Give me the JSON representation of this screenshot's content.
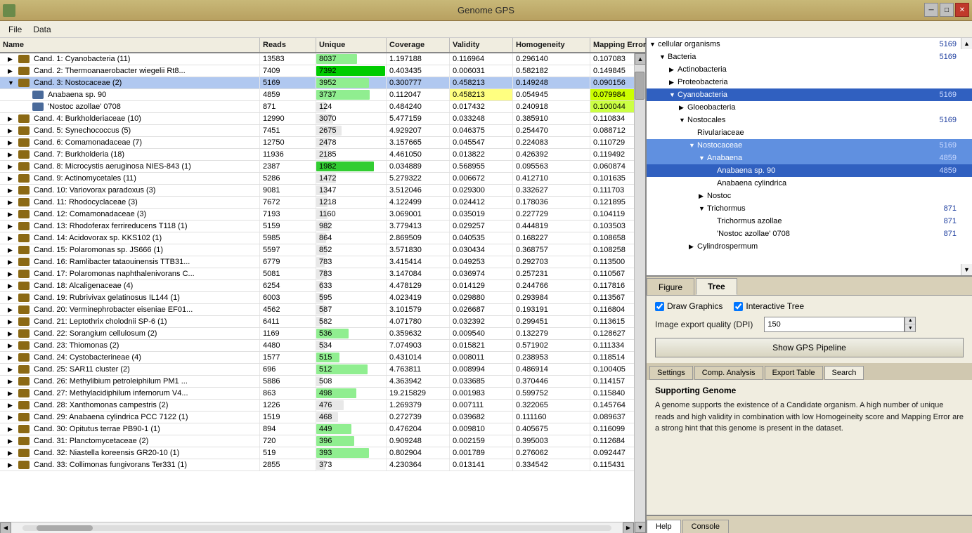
{
  "window": {
    "title": "Genome GPS",
    "icon": "genome-icon"
  },
  "titlebar": {
    "minimize_label": "─",
    "maximize_label": "□",
    "close_label": "✕"
  },
  "menubar": {
    "items": [
      {
        "label": "File",
        "id": "file-menu"
      },
      {
        "label": "Data",
        "id": "data-menu"
      }
    ]
  },
  "table": {
    "columns": [
      "Name",
      "Reads",
      "Unique",
      "Coverage",
      "Validity",
      "Homogeneity",
      "Mapping Error"
    ],
    "rows": [
      {
        "name": "Cand. 1: Cyanobacteria (11)",
        "reads": "13583",
        "unique": "8037",
        "coverage": "1.197188",
        "validity": "0.116964",
        "homogeneity": "0.296140",
        "mapping_error": "0.107083",
        "unique_pct": 59,
        "unique_color": "#90ee90",
        "indent": 0,
        "expanded": false,
        "selected": false
      },
      {
        "name": "Cand. 2: Thermoanaerobacter wiegelii Rt8...",
        "reads": "7409",
        "unique": "7392",
        "coverage": "0.403435",
        "validity": "0.006031",
        "homogeneity": "0.582182",
        "mapping_error": "0.149845",
        "unique_pct": 99,
        "unique_color": "#00cc00",
        "indent": 0,
        "expanded": false,
        "selected": false
      },
      {
        "name": "Cand. 3: Nostocaceae (2)",
        "reads": "5169",
        "unique": "3952",
        "coverage": "0.300777",
        "validity": "0.458213",
        "homogeneity": "0.149248",
        "mapping_error": "0.090156",
        "unique_pct": 76,
        "unique_color": "#90ee90",
        "indent": 0,
        "expanded": true,
        "selected": true
      },
      {
        "name": "Anabaena sp. 90",
        "reads": "4859",
        "unique": "3737",
        "coverage": "0.112047",
        "validity": "0.458213",
        "homogeneity": "0.054945",
        "mapping_error": "0.079984",
        "unique_pct": 77,
        "unique_color": "#90ee90",
        "indent": 1,
        "expanded": false,
        "selected": false,
        "validity_highlight": true,
        "mapping_highlight": true
      },
      {
        "name": "'Nostoc azollae' 0708",
        "reads": "871",
        "unique": "124",
        "coverage": "0.484240",
        "validity": "0.017432",
        "homogeneity": "0.240918",
        "mapping_error": "0.100044",
        "unique_pct": 14,
        "unique_color": "#e8e8e8",
        "indent": 1,
        "expanded": false,
        "selected": false,
        "mapping_yellow": true
      },
      {
        "name": "Cand. 4: Burkholderiaceae (10)",
        "reads": "12990",
        "unique": "3070",
        "coverage": "5.477159",
        "validity": "0.033248",
        "homogeneity": "0.385910",
        "mapping_error": "0.110834",
        "unique_pct": 24,
        "unique_color": "#e8e8e8",
        "indent": 0,
        "expanded": false,
        "selected": false
      },
      {
        "name": "Cand. 5: Synechococcus (5)",
        "reads": "7451",
        "unique": "2675",
        "coverage": "4.929207",
        "validity": "0.046375",
        "homogeneity": "0.254470",
        "mapping_error": "0.088712",
        "unique_pct": 36,
        "unique_color": "#e8e8e8",
        "indent": 0,
        "expanded": false,
        "selected": false
      },
      {
        "name": "Cand. 6: Comamonadaceae (7)",
        "reads": "12750",
        "unique": "2478",
        "coverage": "3.157665",
        "validity": "0.045547",
        "homogeneity": "0.224083",
        "mapping_error": "0.110729",
        "unique_pct": 19,
        "unique_color": "#e8e8e8",
        "indent": 0,
        "expanded": false,
        "selected": false
      },
      {
        "name": "Cand. 7: Burkholderia (18)",
        "reads": "11936",
        "unique": "2185",
        "coverage": "4.461050",
        "validity": "0.013822",
        "homogeneity": "0.426392",
        "mapping_error": "0.119492",
        "unique_pct": 18,
        "unique_color": "#e8e8e8",
        "indent": 0,
        "expanded": false,
        "selected": false
      },
      {
        "name": "Cand. 8: Microcystis aeruginosa NIES-843 (1)",
        "reads": "2387",
        "unique": "1982",
        "coverage": "0.034889",
        "validity": "0.568955",
        "homogeneity": "0.095563",
        "mapping_error": "0.060874",
        "unique_pct": 83,
        "unique_color": "#32cd32",
        "indent": 0,
        "expanded": false,
        "selected": false
      },
      {
        "name": "Cand. 9: Actinomycetales (11)",
        "reads": "5286",
        "unique": "1472",
        "coverage": "5.279322",
        "validity": "0.006672",
        "homogeneity": "0.412710",
        "mapping_error": "0.101635",
        "unique_pct": 28,
        "unique_color": "#e8e8e8",
        "indent": 0,
        "expanded": false,
        "selected": false
      },
      {
        "name": "Cand. 10: Variovorax paradoxus (3)",
        "reads": "9081",
        "unique": "1347",
        "coverage": "3.512046",
        "validity": "0.029300",
        "homogeneity": "0.332627",
        "mapping_error": "0.111703",
        "unique_pct": 15,
        "unique_color": "#e8e8e8",
        "indent": 0,
        "expanded": false,
        "selected": false
      },
      {
        "name": "Cand. 11: Rhodocyclaceae (3)",
        "reads": "7672",
        "unique": "1218",
        "coverage": "4.122499",
        "validity": "0.024412",
        "homogeneity": "0.178036",
        "mapping_error": "0.121895",
        "unique_pct": 16,
        "unique_color": "#e8e8e8",
        "indent": 0,
        "expanded": false,
        "selected": false
      },
      {
        "name": "Cand. 12: Comamonadaceae (3)",
        "reads": "7193",
        "unique": "1160",
        "coverage": "3.069001",
        "validity": "0.035019",
        "homogeneity": "0.227729",
        "mapping_error": "0.104119",
        "unique_pct": 16,
        "unique_color": "#e8e8e8",
        "indent": 0,
        "expanded": false,
        "selected": false
      },
      {
        "name": "Cand. 13: Rhodoferax ferrireducens T118 (1)",
        "reads": "5159",
        "unique": "982",
        "coverage": "3.779413",
        "validity": "0.029257",
        "homogeneity": "0.444819",
        "mapping_error": "0.103503",
        "unique_pct": 19,
        "unique_color": "#e8e8e8",
        "indent": 0,
        "expanded": false,
        "selected": false
      },
      {
        "name": "Cand. 14: Acidovorax sp. KKS102 (1)",
        "reads": "5985",
        "unique": "864",
        "coverage": "2.869509",
        "validity": "0.040535",
        "homogeneity": "0.168227",
        "mapping_error": "0.108658",
        "unique_pct": 14,
        "unique_color": "#e8e8e8",
        "indent": 0,
        "expanded": false,
        "selected": false
      },
      {
        "name": "Cand. 15: Polaromonas sp. JS666 (1)",
        "reads": "5597",
        "unique": "852",
        "coverage": "3.571830",
        "validity": "0.030434",
        "homogeneity": "0.368757",
        "mapping_error": "0.108258",
        "unique_pct": 15,
        "unique_color": "#e8e8e8",
        "indent": 0,
        "expanded": false,
        "selected": false
      },
      {
        "name": "Cand. 16: Ramlibacter tataouinensis TTB31...",
        "reads": "6779",
        "unique": "783",
        "coverage": "3.415414",
        "validity": "0.049253",
        "homogeneity": "0.292703",
        "mapping_error": "0.113500",
        "unique_pct": 12,
        "unique_color": "#e8e8e8",
        "indent": 0,
        "expanded": false,
        "selected": false
      },
      {
        "name": "Cand. 17: Polaromonas naphthalenivorans C...",
        "reads": "5081",
        "unique": "783",
        "coverage": "3.147084",
        "validity": "0.036974",
        "homogeneity": "0.257231",
        "mapping_error": "0.110567",
        "unique_pct": 15,
        "unique_color": "#e8e8e8",
        "indent": 0,
        "expanded": false,
        "selected": false
      },
      {
        "name": "Cand. 18: Alcaligenaceae (4)",
        "reads": "6254",
        "unique": "633",
        "coverage": "4.478129",
        "validity": "0.014129",
        "homogeneity": "0.244766",
        "mapping_error": "0.117816",
        "unique_pct": 10,
        "unique_color": "#e8e8e8",
        "indent": 0,
        "expanded": false,
        "selected": false
      },
      {
        "name": "Cand. 19: Rubrivivax gelatinosus IL144 (1)",
        "reads": "6003",
        "unique": "595",
        "coverage": "4.023419",
        "validity": "0.029880",
        "homogeneity": "0.293984",
        "mapping_error": "0.113567",
        "unique_pct": 10,
        "unique_color": "#e8e8e8",
        "indent": 0,
        "expanded": false,
        "selected": false
      },
      {
        "name": "Cand. 20: Verminephrobacter eiseniae EF01...",
        "reads": "4562",
        "unique": "587",
        "coverage": "3.101579",
        "validity": "0.026687",
        "homogeneity": "0.193191",
        "mapping_error": "0.116804",
        "unique_pct": 13,
        "unique_color": "#e8e8e8",
        "indent": 0,
        "expanded": false,
        "selected": false
      },
      {
        "name": "Cand. 21: Leptothrix cholodnii SP-6 (1)",
        "reads": "6411",
        "unique": "582",
        "coverage": "4.071780",
        "validity": "0.032392",
        "homogeneity": "0.299451",
        "mapping_error": "0.113615",
        "unique_pct": 9,
        "unique_color": "#e8e8e8",
        "indent": 0,
        "expanded": false,
        "selected": false
      },
      {
        "name": "Cand. 22: Sorangium cellulosum (2)",
        "reads": "1169",
        "unique": "536",
        "coverage": "0.359632",
        "validity": "0.009540",
        "homogeneity": "0.132279",
        "mapping_error": "0.128627",
        "unique_pct": 46,
        "unique_color": "#90ee90",
        "indent": 0,
        "expanded": false,
        "selected": false
      },
      {
        "name": "Cand. 23: Thiomonas (2)",
        "reads": "4480",
        "unique": "534",
        "coverage": "7.074903",
        "validity": "0.015821",
        "homogeneity": "0.571902",
        "mapping_error": "0.111334",
        "unique_pct": 12,
        "unique_color": "#e8e8e8",
        "indent": 0,
        "expanded": false,
        "selected": false
      },
      {
        "name": "Cand. 24: Cystobacterineae (4)",
        "reads": "1577",
        "unique": "515",
        "coverage": "0.431014",
        "validity": "0.008011",
        "homogeneity": "0.238953",
        "mapping_error": "0.118514",
        "unique_pct": 33,
        "unique_color": "#90ee90",
        "indent": 0,
        "expanded": false,
        "selected": false
      },
      {
        "name": "Cand. 25: SAR11 cluster (2)",
        "reads": "696",
        "unique": "512",
        "coverage": "4.763811",
        "validity": "0.008994",
        "homogeneity": "0.486914",
        "mapping_error": "0.100405",
        "unique_pct": 74,
        "unique_color": "#90ee90",
        "indent": 0,
        "expanded": false,
        "selected": false
      },
      {
        "name": "Cand. 26: Methylibium petroleiphilum PM1 ...",
        "reads": "5886",
        "unique": "508",
        "coverage": "4.363942",
        "validity": "0.033685",
        "homogeneity": "0.370446",
        "mapping_error": "0.114157",
        "unique_pct": 9,
        "unique_color": "#e8e8e8",
        "indent": 0,
        "expanded": false,
        "selected": false
      },
      {
        "name": "Cand. 27: Methylacidiphilum infernorum V4...",
        "reads": "863",
        "unique": "498",
        "coverage": "19.215829",
        "validity": "0.001983",
        "homogeneity": "0.599752",
        "mapping_error": "0.115840",
        "unique_pct": 58,
        "unique_color": "#90ee90",
        "indent": 0,
        "expanded": false,
        "selected": false
      },
      {
        "name": "Cand. 28: Xanthomonas campestris (2)",
        "reads": "1226",
        "unique": "476",
        "coverage": "1.269379",
        "validity": "0.007111",
        "homogeneity": "0.322065",
        "mapping_error": "0.145764",
        "unique_pct": 39,
        "unique_color": "#e8e8e8",
        "indent": 0,
        "expanded": false,
        "selected": false
      },
      {
        "name": "Cand. 29: Anabaena cylindrica PCC 7122 (1)",
        "reads": "1519",
        "unique": "468",
        "coverage": "0.272739",
        "validity": "0.039682",
        "homogeneity": "0.111160",
        "mapping_error": "0.089637",
        "unique_pct": 31,
        "unique_color": "#e8e8e8",
        "indent": 0,
        "expanded": false,
        "selected": false
      },
      {
        "name": "Cand. 30: Opitutus terrae PB90-1 (1)",
        "reads": "894",
        "unique": "449",
        "coverage": "0.476204",
        "validity": "0.009810",
        "homogeneity": "0.405675",
        "mapping_error": "0.116099",
        "unique_pct": 50,
        "unique_color": "#90ee90",
        "indent": 0,
        "expanded": false,
        "selected": false
      },
      {
        "name": "Cand. 31: Planctomycetaceae (2)",
        "reads": "720",
        "unique": "396",
        "coverage": "0.909248",
        "validity": "0.002159",
        "homogeneity": "0.395003",
        "mapping_error": "0.112684",
        "unique_pct": 55,
        "unique_color": "#90ee90",
        "indent": 0,
        "expanded": false,
        "selected": false
      },
      {
        "name": "Cand. 32: Niastella koreensis GR20-10 (1)",
        "reads": "519",
        "unique": "393",
        "coverage": "0.802904",
        "validity": "0.001789",
        "homogeneity": "0.276062",
        "mapping_error": "0.092447",
        "unique_pct": 76,
        "unique_color": "#90ee90",
        "indent": 0,
        "expanded": false,
        "selected": false
      },
      {
        "name": "Cand. 33: Collimonas fungivorans Ter331 (1)",
        "reads": "2855",
        "unique": "373",
        "coverage": "4.230364",
        "validity": "0.013141",
        "homogeneity": "0.334542",
        "mapping_error": "0.115431",
        "unique_pct": 13,
        "unique_color": "#e8e8e8",
        "indent": 0,
        "expanded": false,
        "selected": false
      }
    ]
  },
  "tree": {
    "items": [
      {
        "label": "cellular organisms",
        "count": "5169",
        "depth": 0,
        "expanded": true,
        "selected": false,
        "icon": "expand"
      },
      {
        "label": "Bacteria",
        "count": "5169",
        "depth": 1,
        "expanded": true,
        "selected": false,
        "icon": "expand"
      },
      {
        "label": "Actinobacteria",
        "count": "",
        "depth": 2,
        "expanded": false,
        "selected": false,
        "icon": "expand"
      },
      {
        "label": "Proteobacteria",
        "count": "",
        "depth": 2,
        "expanded": false,
        "selected": false,
        "icon": "expand"
      },
      {
        "label": "Cyanobacteria",
        "count": "5169",
        "depth": 2,
        "expanded": true,
        "selected": true,
        "icon": "expand"
      },
      {
        "label": "Gloeobacteria",
        "count": "",
        "depth": 3,
        "expanded": false,
        "selected": false,
        "icon": "expand"
      },
      {
        "label": "Nostocales",
        "count": "5169",
        "depth": 3,
        "expanded": true,
        "selected": false,
        "icon": "expand"
      },
      {
        "label": "Rivulariaceae",
        "count": "",
        "depth": 4,
        "expanded": false,
        "selected": false,
        "icon": "leaf"
      },
      {
        "label": "Nostocaceae",
        "count": "5169",
        "depth": 4,
        "expanded": true,
        "selected": false,
        "icon": "expand",
        "highlight": "blue"
      },
      {
        "label": "Anabaena",
        "count": "4859",
        "depth": 5,
        "expanded": true,
        "selected": false,
        "icon": "expand",
        "highlight": "blue"
      },
      {
        "label": "Anabaena sp. 90",
        "count": "4859",
        "depth": 6,
        "expanded": false,
        "selected": true,
        "icon": "leaf",
        "highlight": "darkblue"
      },
      {
        "label": "Anabaena cylindrica",
        "count": "",
        "depth": 6,
        "expanded": false,
        "selected": false,
        "icon": "leaf"
      },
      {
        "label": "Nostoc",
        "count": "",
        "depth": 5,
        "expanded": false,
        "selected": false,
        "icon": "expand"
      },
      {
        "label": "Trichormus",
        "count": "871",
        "depth": 5,
        "expanded": true,
        "selected": false,
        "icon": "expand"
      },
      {
        "label": "Trichormus azollae",
        "count": "871",
        "depth": 6,
        "expanded": false,
        "selected": false,
        "icon": "leaf"
      },
      {
        "label": "'Nostoc azollae' 0708",
        "count": "871",
        "depth": 6,
        "expanded": false,
        "selected": false,
        "icon": "leaf"
      },
      {
        "label": "Cylindrospermum",
        "count": "",
        "depth": 4,
        "expanded": false,
        "selected": false,
        "icon": "expand"
      }
    ]
  },
  "tabs": {
    "figure_label": "Figure",
    "tree_label": "Tree",
    "active": "tree"
  },
  "controls": {
    "draw_graphics_label": "Draw Graphics",
    "draw_graphics_checked": true,
    "interactive_tree_label": "Interactive Tree",
    "interactive_tree_checked": true,
    "dpi_label": "Image export quality (DPI)",
    "dpi_value": "150",
    "pipeline_button_label": "Show GPS Pipeline"
  },
  "bottom_tabs": {
    "settings_label": "Settings",
    "comp_analysis_label": "Comp. Analysis",
    "export_table_label": "Export Table",
    "search_label": "Search",
    "active": "search"
  },
  "supporting": {
    "title": "Supporting Genome",
    "text": "A genome supports the existence of a Candidate organism. A high number of unique reads and high validity in combination with low Homogeineity score and Mapping Error are a strong hint that this genome is present in the dataset."
  },
  "footer": {
    "help_label": "Help",
    "console_label": "Console"
  }
}
